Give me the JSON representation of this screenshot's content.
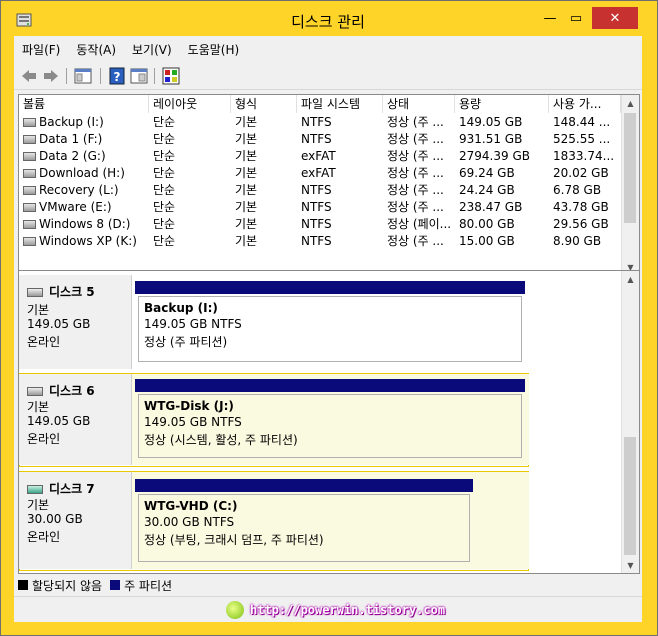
{
  "window": {
    "title": "디스크 관리",
    "controls": {
      "minimize": "—",
      "maximize": "▭",
      "close": "✕"
    }
  },
  "menu": [
    "파일(F)",
    "동작(A)",
    "보기(V)",
    "도움말(H)"
  ],
  "toolbar": {
    "icons": [
      "back-arrow-icon",
      "forward-arrow-icon",
      "console-tree-icon",
      "help-icon",
      "properties-icon",
      "disk-settings-icon"
    ]
  },
  "volume_list": {
    "columns": [
      "볼륨",
      "레이아웃",
      "형식",
      "파일 시스템",
      "상태",
      "용량",
      "사용 가..."
    ],
    "rows": [
      [
        "Backup (I:)",
        "단순",
        "기본",
        "NTFS",
        "정상 (주 ...",
        "149.05 GB",
        "148.44 ..."
      ],
      [
        "Data 1 (F:)",
        "단순",
        "기본",
        "NTFS",
        "정상 (주 ...",
        "931.51 GB",
        "525.55 ..."
      ],
      [
        "Data 2 (G:)",
        "단순",
        "기본",
        "exFAT",
        "정상 (주 ...",
        "2794.39 GB",
        "1833.74..."
      ],
      [
        "Download (H:)",
        "단순",
        "기본",
        "exFAT",
        "정상 (주 ...",
        "69.24 GB",
        "20.02 GB"
      ],
      [
        "Recovery (L:)",
        "단순",
        "기본",
        "NTFS",
        "정상 (주 ...",
        "24.24 GB",
        "6.78 GB"
      ],
      [
        "VMware (E:)",
        "단순",
        "기본",
        "NTFS",
        "정상 (주 ...",
        "238.47 GB",
        "43.78 GB"
      ],
      [
        "Windows 8 (D:)",
        "단순",
        "기본",
        "NTFS",
        "정상 (페이...",
        "80.00 GB",
        "29.56 GB"
      ],
      [
        "Windows XP (K:)",
        "단순",
        "기본",
        "NTFS",
        "정상 (주 ...",
        "15.00 GB",
        "8.90 GB"
      ]
    ]
  },
  "disks": [
    {
      "name": "디스크 5",
      "type": "기본",
      "size": "149.05 GB",
      "status": "온라인",
      "partition": {
        "name": "Backup  (I:)",
        "size_fs": "149.05 GB NTFS",
        "status": "정상 (주 파티션)"
      }
    },
    {
      "name": "디스크 6",
      "type": "기본",
      "size": "149.05 GB",
      "status": "온라인",
      "partition": {
        "name": "WTG-Disk  (J:)",
        "size_fs": "149.05 GB NTFS",
        "status": "정상 (시스템, 활성, 주 파티션)"
      }
    },
    {
      "name": "디스크 7",
      "type": "기본",
      "size": "30.00 GB",
      "status": "온라인",
      "partition": {
        "name": "WTG-VHD  (C:)",
        "size_fs": "30.00 GB NTFS",
        "status": "정상 (부팅, 크래시 덤프, 주 파티션)"
      }
    }
  ],
  "legend": [
    {
      "label": "할당되지 않음",
      "color": "#000000"
    },
    {
      "label": "주 파티션",
      "color": "#0a0a7a"
    }
  ],
  "watermark": "http://powerwin.tistory.com",
  "colors": {
    "window_frame": "#ffd428",
    "close_button": "#c7312f",
    "partition_bar": "#0a0a7a",
    "selection_border": "#e8c800"
  }
}
